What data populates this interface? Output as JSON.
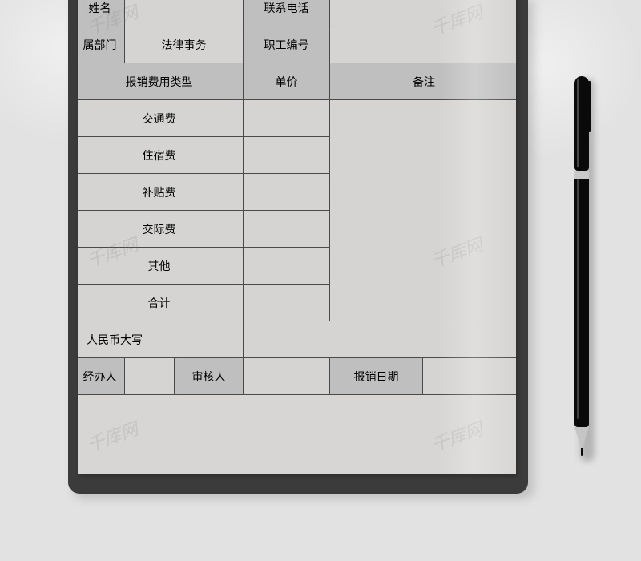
{
  "watermark": "千库网",
  "info": {
    "name_label": "姓名",
    "name_value": "",
    "phone_label": "联系电话",
    "phone_value": "",
    "dept_label": "属部门",
    "dept_value": "法律事务",
    "empno_label": "职工编号",
    "empno_value": ""
  },
  "headers": {
    "expense_type": "报销费用类型",
    "unit_price": "单价",
    "remark": "备注"
  },
  "expenses": [
    {
      "type": "交通费",
      "price": ""
    },
    {
      "type": "住宿费",
      "price": ""
    },
    {
      "type": "补贴费",
      "price": ""
    },
    {
      "type": "交际费",
      "price": ""
    },
    {
      "type": "其他",
      "price": ""
    },
    {
      "type": "合计",
      "price": ""
    }
  ],
  "remark_value": "",
  "rmb_caps_label": "人民币大写",
  "rmb_caps_value": "",
  "footer": {
    "handler_label": "经办人",
    "handler_value": "",
    "reviewer_label": "审核人",
    "reviewer_value": "",
    "date_label": "报销日期",
    "date_value": ""
  }
}
